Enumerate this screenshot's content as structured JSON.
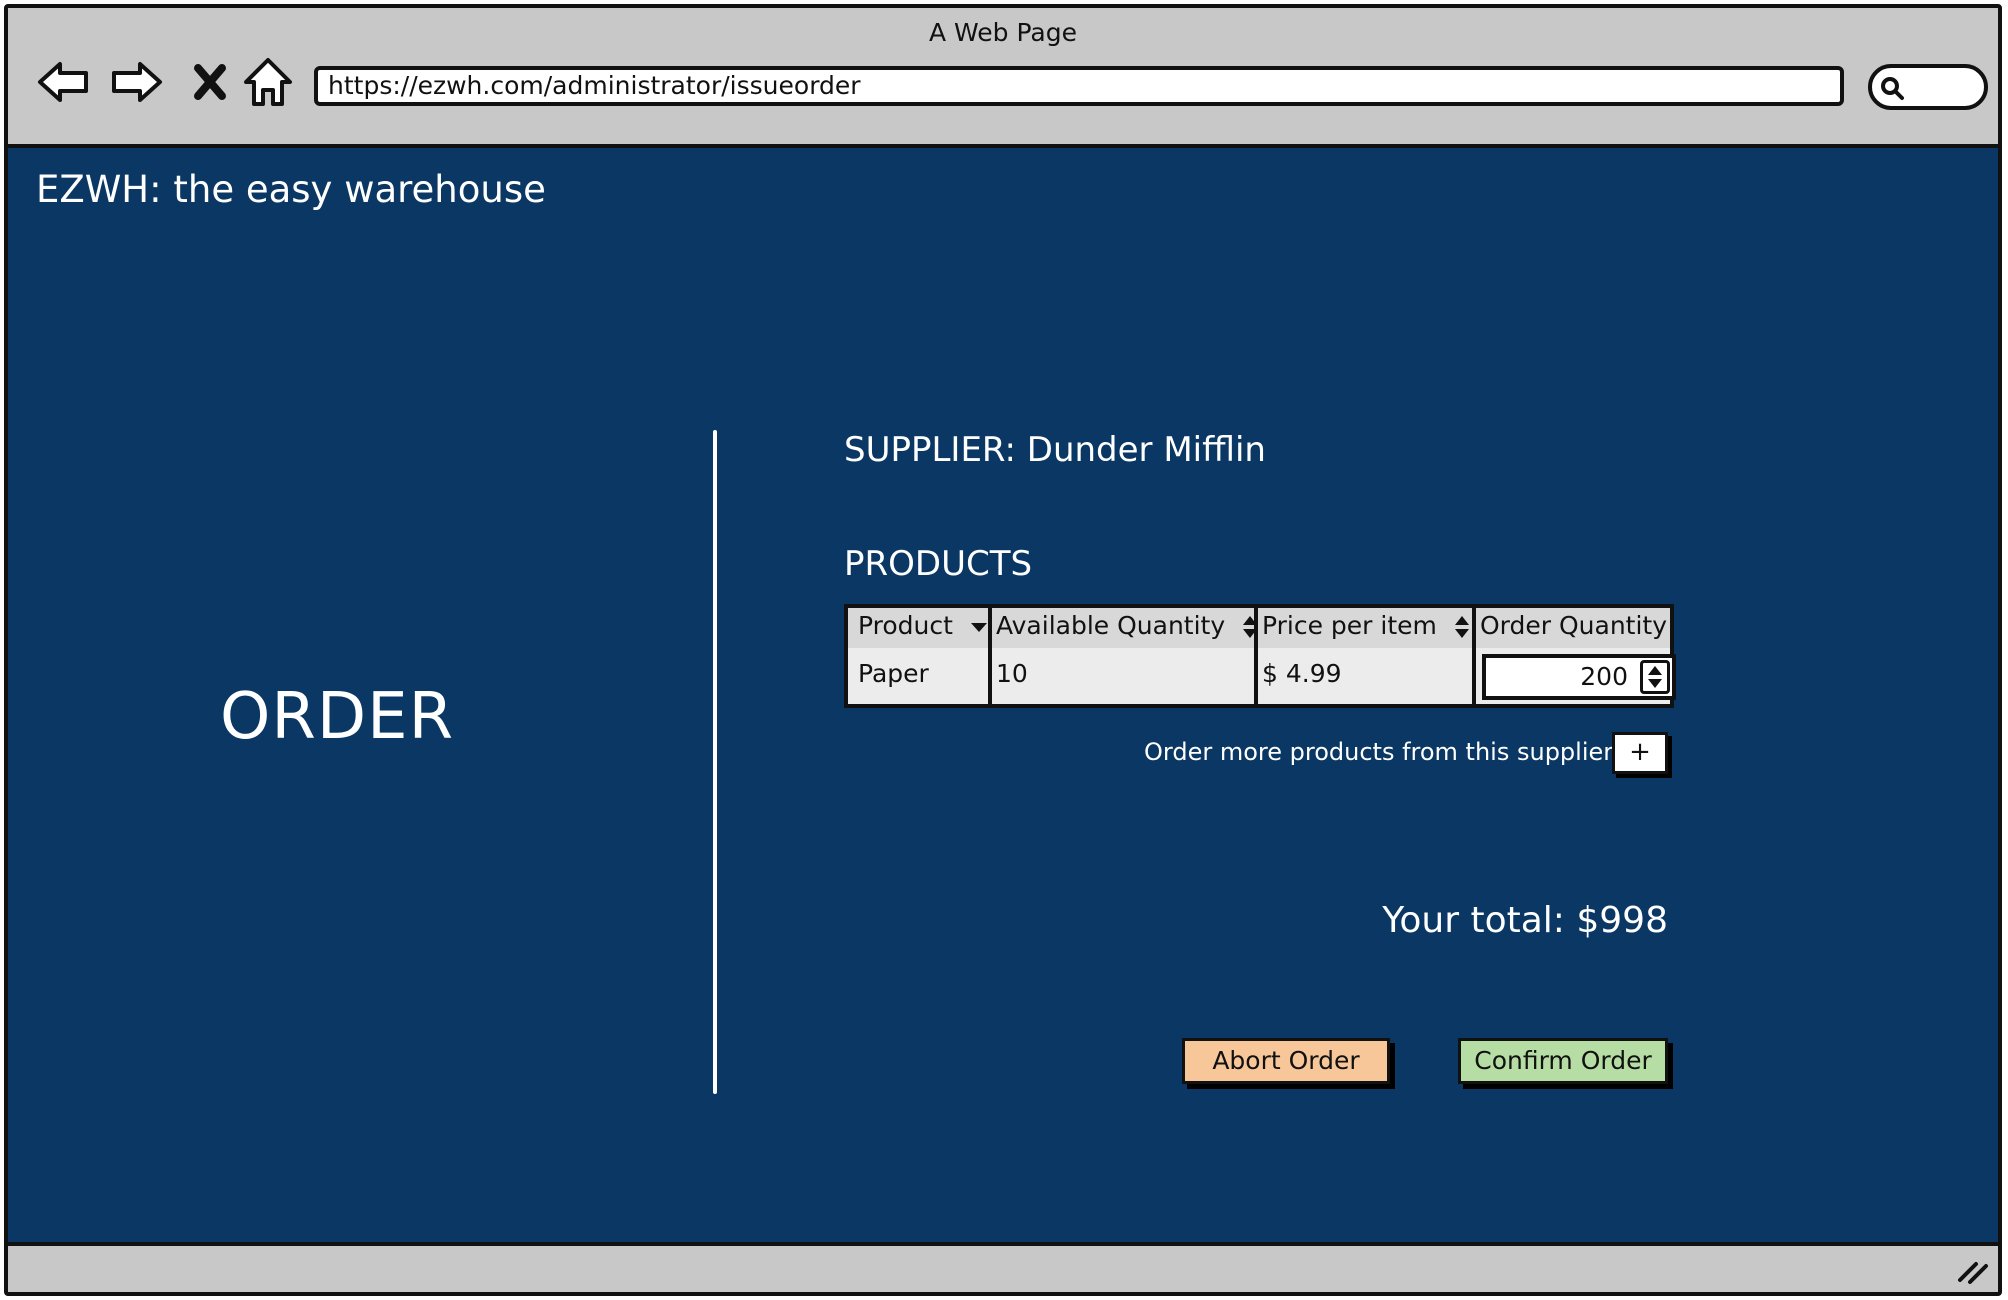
{
  "browser": {
    "title": "A Web Page",
    "url": "https://ezwh.com/administrator/issueorder"
  },
  "app": {
    "title": "EZWH: the easy warehouse"
  },
  "page": {
    "heading": "ORDER",
    "supplier_label": "SUPPLIER: Dunder Mifflin",
    "products_label": "PRODUCTS"
  },
  "table": {
    "columns": [
      "Product",
      "Available Quantity",
      "Price per item",
      "Order Quantity"
    ],
    "rows": [
      {
        "product": "Paper",
        "available_quantity": "10",
        "price_per_item": "$ 4.99",
        "order_quantity": "200"
      }
    ]
  },
  "more_products": {
    "label": "Order more products from this supplier",
    "button_label": "+"
  },
  "total": "Your total: $998",
  "actions": {
    "abort_label": "Abort Order",
    "confirm_label": "Confirm Order"
  },
  "colors": {
    "page_background": "#0a3763",
    "abort_button": "#f7c799",
    "confirm_button": "#b6dea4"
  }
}
